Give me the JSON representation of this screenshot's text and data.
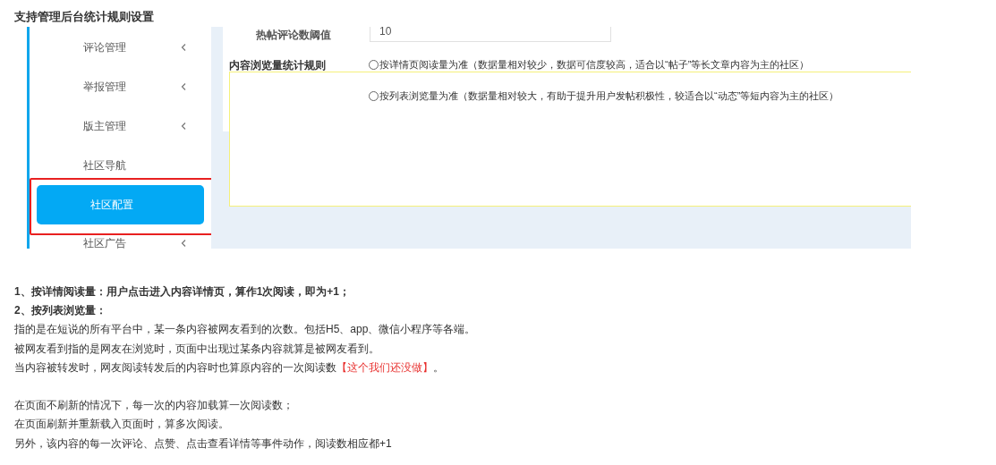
{
  "title": "支持管理后台统计规则设置",
  "sidebar": {
    "items": [
      {
        "label": "评论管理",
        "has_submenu": true,
        "selected": false
      },
      {
        "label": "举报管理",
        "has_submenu": true,
        "selected": false
      },
      {
        "label": "版主管理",
        "has_submenu": true,
        "selected": false
      },
      {
        "label": "社区导航",
        "has_submenu": false,
        "selected": false
      },
      {
        "label": "社区配置",
        "has_submenu": false,
        "selected": true
      },
      {
        "label": "社区广告",
        "has_submenu": true,
        "selected": false
      }
    ]
  },
  "form": {
    "threshold": {
      "label": "热帖评论数阈值",
      "value": "10"
    },
    "rule": {
      "label": "内容浏览量统计规则",
      "options": [
        {
          "label": "按详情页阅读量为准（数据量相对较少，数据可信度较高，适合以“帖子”等长文章内容为主的社区）",
          "selected": false
        },
        {
          "label": "按列表浏览量为准（数据量相对较大，有助于提升用户发帖积极性，较适合以“动态”等短内容为主的社区）",
          "selected": false
        }
      ]
    }
  },
  "notes": [
    {
      "kind": "heading",
      "text": "1、按详情阅读量：用户点击进入内容详情页，算作1次阅读，即为+1；"
    },
    {
      "kind": "heading",
      "text": "2、按列表浏览量："
    },
    {
      "kind": "text",
      "text": "指的是在短说的所有平台中，某一条内容被网友看到的次数。包括H5、app、微信小程序等各端。"
    },
    {
      "kind": "text",
      "text": "被网友看到指的是网友在浏览时，页面中出现过某条内容就算是被网友看到。"
    },
    {
      "kind": "highlight",
      "text": "当内容被转发时，网友阅读转发后的内容时也算原内容的一次阅读数",
      "highlight": "【这个我们还没做】",
      "after": "。"
    },
    {
      "kind": "blank"
    },
    {
      "kind": "text",
      "text": "在页面不刷新的情况下，每一次的内容加载算一次阅读数；"
    },
    {
      "kind": "text",
      "text": "在页面刷新并重新载入页面时，算多次阅读。"
    },
    {
      "kind": "text",
      "text": "另外，该内容的每一次评论、点赞、点击查看详情等事件动作，阅读数相应都+1"
    }
  ]
}
